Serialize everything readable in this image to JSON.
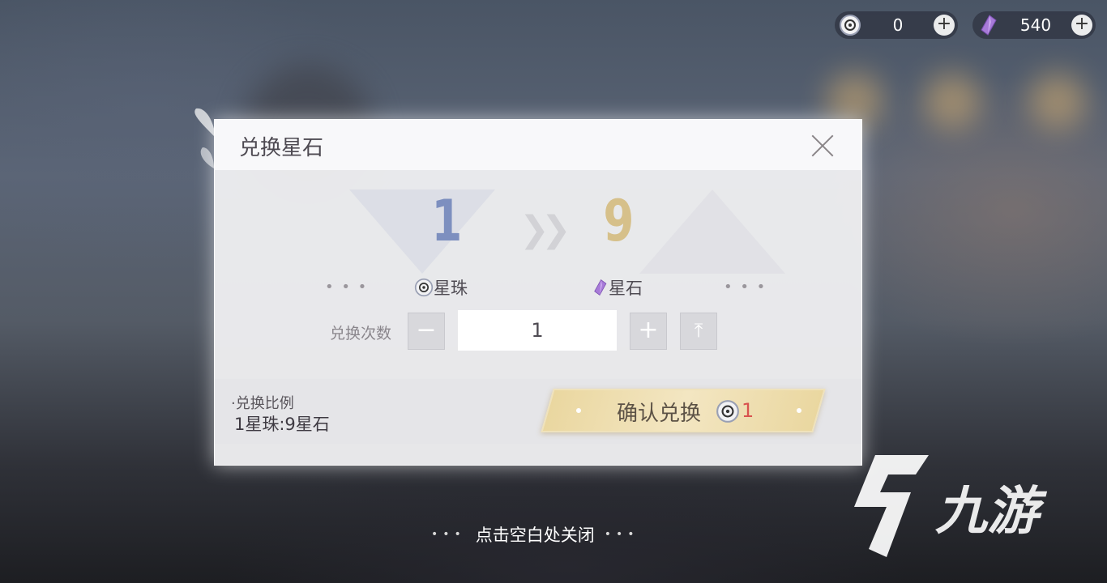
{
  "topbar": {
    "stellar_pearl": {
      "icon": "stellar-pearl-icon",
      "value": "0",
      "add": "+"
    },
    "stellar_stone": {
      "icon": "stellar-stone-icon",
      "value": "540",
      "add": "+"
    }
  },
  "dialog": {
    "title": "兑换星石",
    "from_amount": "1",
    "to_amount": "9",
    "from_name": "星珠",
    "to_name": "星石",
    "count_label": "兑换次数",
    "minus": "−",
    "quantity": "1",
    "plus": "+",
    "max": "⤒",
    "ratio_title": "·兑换比例",
    "ratio_value": "1星珠:9星石",
    "confirm_label": "确认兑换",
    "confirm_cost": "1"
  },
  "hint": "点击空白处关闭",
  "watermark": "九游",
  "colors": {
    "from_number": "#7d8fbf",
    "to_number": "#d6c08a",
    "cost": "#d9534f",
    "button_gold": "#ead7a0"
  }
}
